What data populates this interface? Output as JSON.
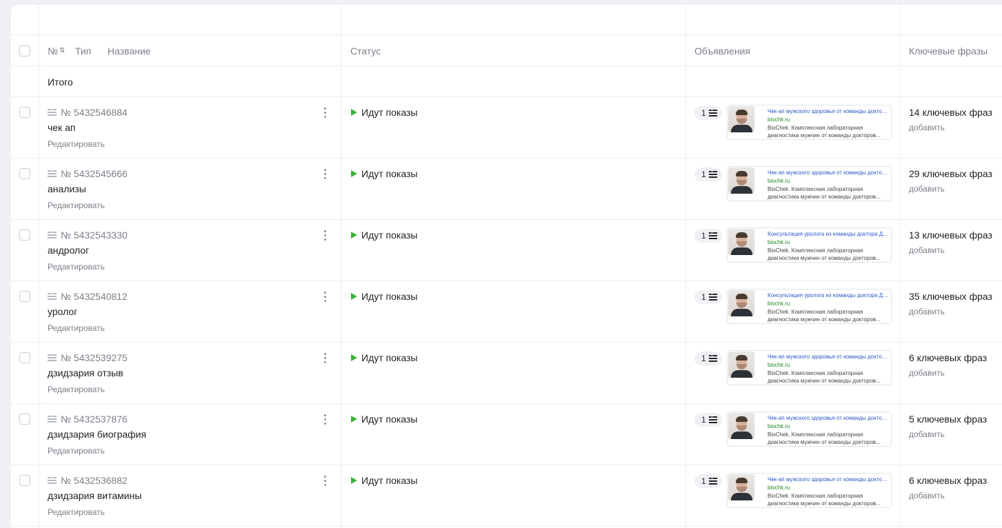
{
  "header": {
    "number_label": "№",
    "type_label": "Тип",
    "name_label": "Название",
    "status_label": "Статус",
    "ads_label": "Объявления",
    "keywords_label": "Ключевые фразы"
  },
  "total": {
    "label": "Итого"
  },
  "icons": {
    "sort": "sort-icon",
    "group": "ad-group-icon",
    "menu": "more-vertical-icon",
    "status": "play-icon",
    "ads": "ads-list-icon"
  },
  "colors": {
    "status_active": "#3db13a",
    "ad_title": "#2a56c6",
    "ad_domain": "#1f8b24"
  },
  "groups": [
    {
      "number": "№ 5432546884",
      "name": "чек ап",
      "edit_label": "Редактировать",
      "status": "Идут показы",
      "ads_count": "1",
      "ad": {
        "title": "Чек-ап мужского здоровья от команды доктора Дзидзария",
        "domain": "biochk.ru",
        "description": "BioChek. Комплексная лабораторная диагностика мужчин от команды докторов..."
      },
      "keywords": "14 ключевых фраз",
      "add_label": "добавить"
    },
    {
      "number": "№ 5432545666",
      "name": "анализы",
      "edit_label": "Редактировать",
      "status": "Идут показы",
      "ads_count": "1",
      "ad": {
        "title": "Чек-ап мужского здоровья от команды доктора Дзидзария",
        "domain": "biochk.ru",
        "description": "BioChek. Комплексная лабораторная диагностика мужчин от команды докторов..."
      },
      "keywords": "29 ключевых фраз",
      "add_label": "добавить"
    },
    {
      "number": "№ 5432543330",
      "name": "андролог",
      "edit_label": "Редактировать",
      "status": "Идут показы",
      "ads_count": "1",
      "ad": {
        "title": "Консультация уролога из команды доктора Дзидзария",
        "domain": "biochk.ru",
        "description": "BioChek. Комплексная лабораторная диагностика мужчин от команды докторов..."
      },
      "keywords": "13 ключевых фраз",
      "add_label": "добавить"
    },
    {
      "number": "№ 5432540812",
      "name": "уролог",
      "edit_label": "Редактировать",
      "status": "Идут показы",
      "ads_count": "1",
      "ad": {
        "title": "Консультация уролога из команды доктора Дзидзария",
        "domain": "biochk.ru",
        "description": "BioChek. Комплексная лабораторная диагностика мужчин от команды докторов..."
      },
      "keywords": "35 ключевых фраз",
      "add_label": "добавить"
    },
    {
      "number": "№ 5432539275",
      "name": "дзидзария отзыв",
      "edit_label": "Редактировать",
      "status": "Идут показы",
      "ads_count": "1",
      "ad": {
        "title": "Чек-ап мужского здоровья от команды доктора Дзидзария",
        "domain": "biochk.ru",
        "description": "BioChek. Комплексная лабораторная диагностика мужчин от команды докторов..."
      },
      "keywords": "6 ключевых фраз",
      "add_label": "добавить"
    },
    {
      "number": "№ 5432537876",
      "name": "дзидзария биография",
      "edit_label": "Редактировать",
      "status": "Идут показы",
      "ads_count": "1",
      "ad": {
        "title": "Чек-ап мужского здоровья от команды доктора Дзидзария",
        "domain": "biochk.ru",
        "description": "BioChek. Комплексная лабораторная диагностика мужчин от команды докторов..."
      },
      "keywords": "5 ключевых фраз",
      "add_label": "добавить"
    },
    {
      "number": "№ 5432536882",
      "name": "дзидзария витамины",
      "edit_label": "Редактировать",
      "status": "Идут показы",
      "ads_count": "1",
      "ad": {
        "title": "Чек-ап мужского здоровья от команды доктора Дзидзария",
        "domain": "biochk.ru",
        "description": "BioChek. Комплексная лабораторная диагностика мужчин от команды докторов..."
      },
      "keywords": "6 ключевых фраз",
      "add_label": "добавить"
    }
  ]
}
